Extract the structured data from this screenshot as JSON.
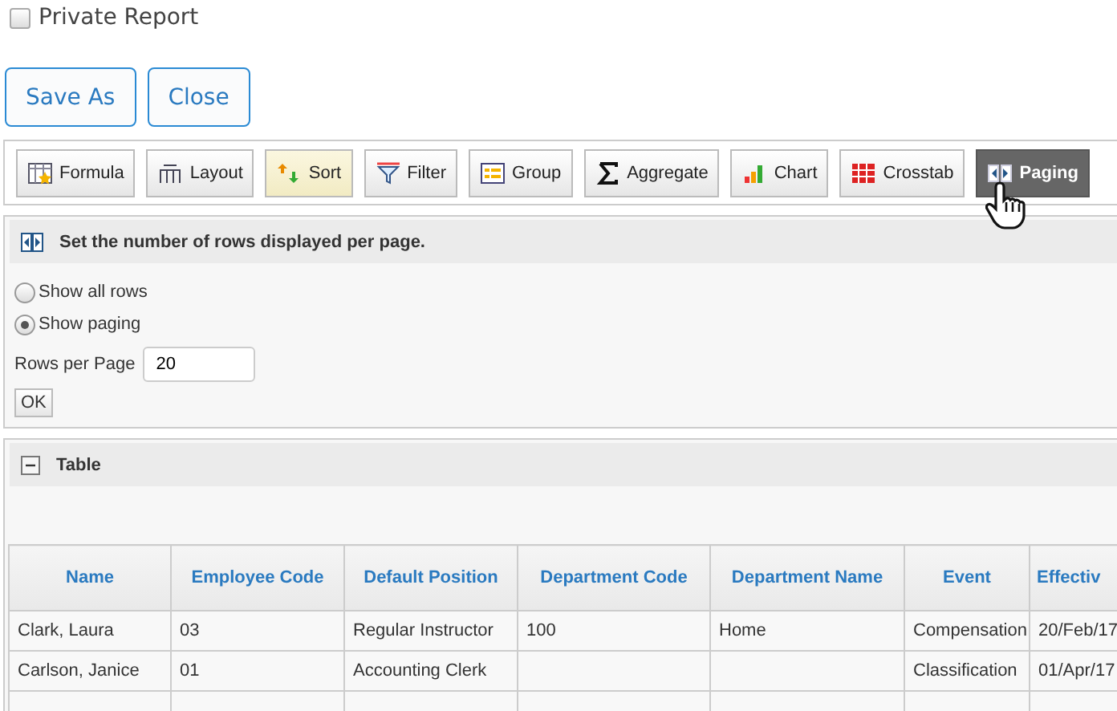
{
  "private_report": {
    "label": "Private Report",
    "checked": false
  },
  "actions": [
    "Save As",
    "Close"
  ],
  "toolbar": [
    {
      "label": "Formula",
      "selected": false,
      "highlighted": false
    },
    {
      "label": "Layout",
      "selected": false,
      "highlighted": false
    },
    {
      "label": "Sort",
      "selected": false,
      "highlighted": true
    },
    {
      "label": "Filter",
      "selected": false,
      "highlighted": false
    },
    {
      "label": "Group",
      "selected": false,
      "highlighted": false
    },
    {
      "label": "Aggregate",
      "selected": false,
      "highlighted": false
    },
    {
      "label": "Chart",
      "selected": false,
      "highlighted": false
    },
    {
      "label": "Crosstab",
      "selected": false,
      "highlighted": false
    },
    {
      "label": "Paging",
      "selected": true,
      "highlighted": false
    }
  ],
  "paging_panel": {
    "title": "Set the number of rows displayed per page.",
    "options": [
      {
        "label": "Show all rows",
        "selected": false
      },
      {
        "label": "Show paging",
        "selected": true
      }
    ],
    "rows_label": "Rows per Page",
    "rows_value": "20",
    "ok": "OK"
  },
  "table_panel": {
    "title": "Table",
    "expanded": true,
    "columns": [
      "Name",
      "Employee Code",
      "Default Position",
      "Department Code",
      "Department Name",
      "Event",
      "Effectiv"
    ],
    "rows": [
      [
        "Clark, Laura",
        "03",
        "Regular Instructor",
        "100",
        "Home",
        "Compensation",
        "20/Feb/17"
      ],
      [
        "Carlson, Janice",
        "01",
        "Accounting Clerk",
        "",
        "",
        "Classification",
        "01/Apr/17"
      ]
    ]
  }
}
